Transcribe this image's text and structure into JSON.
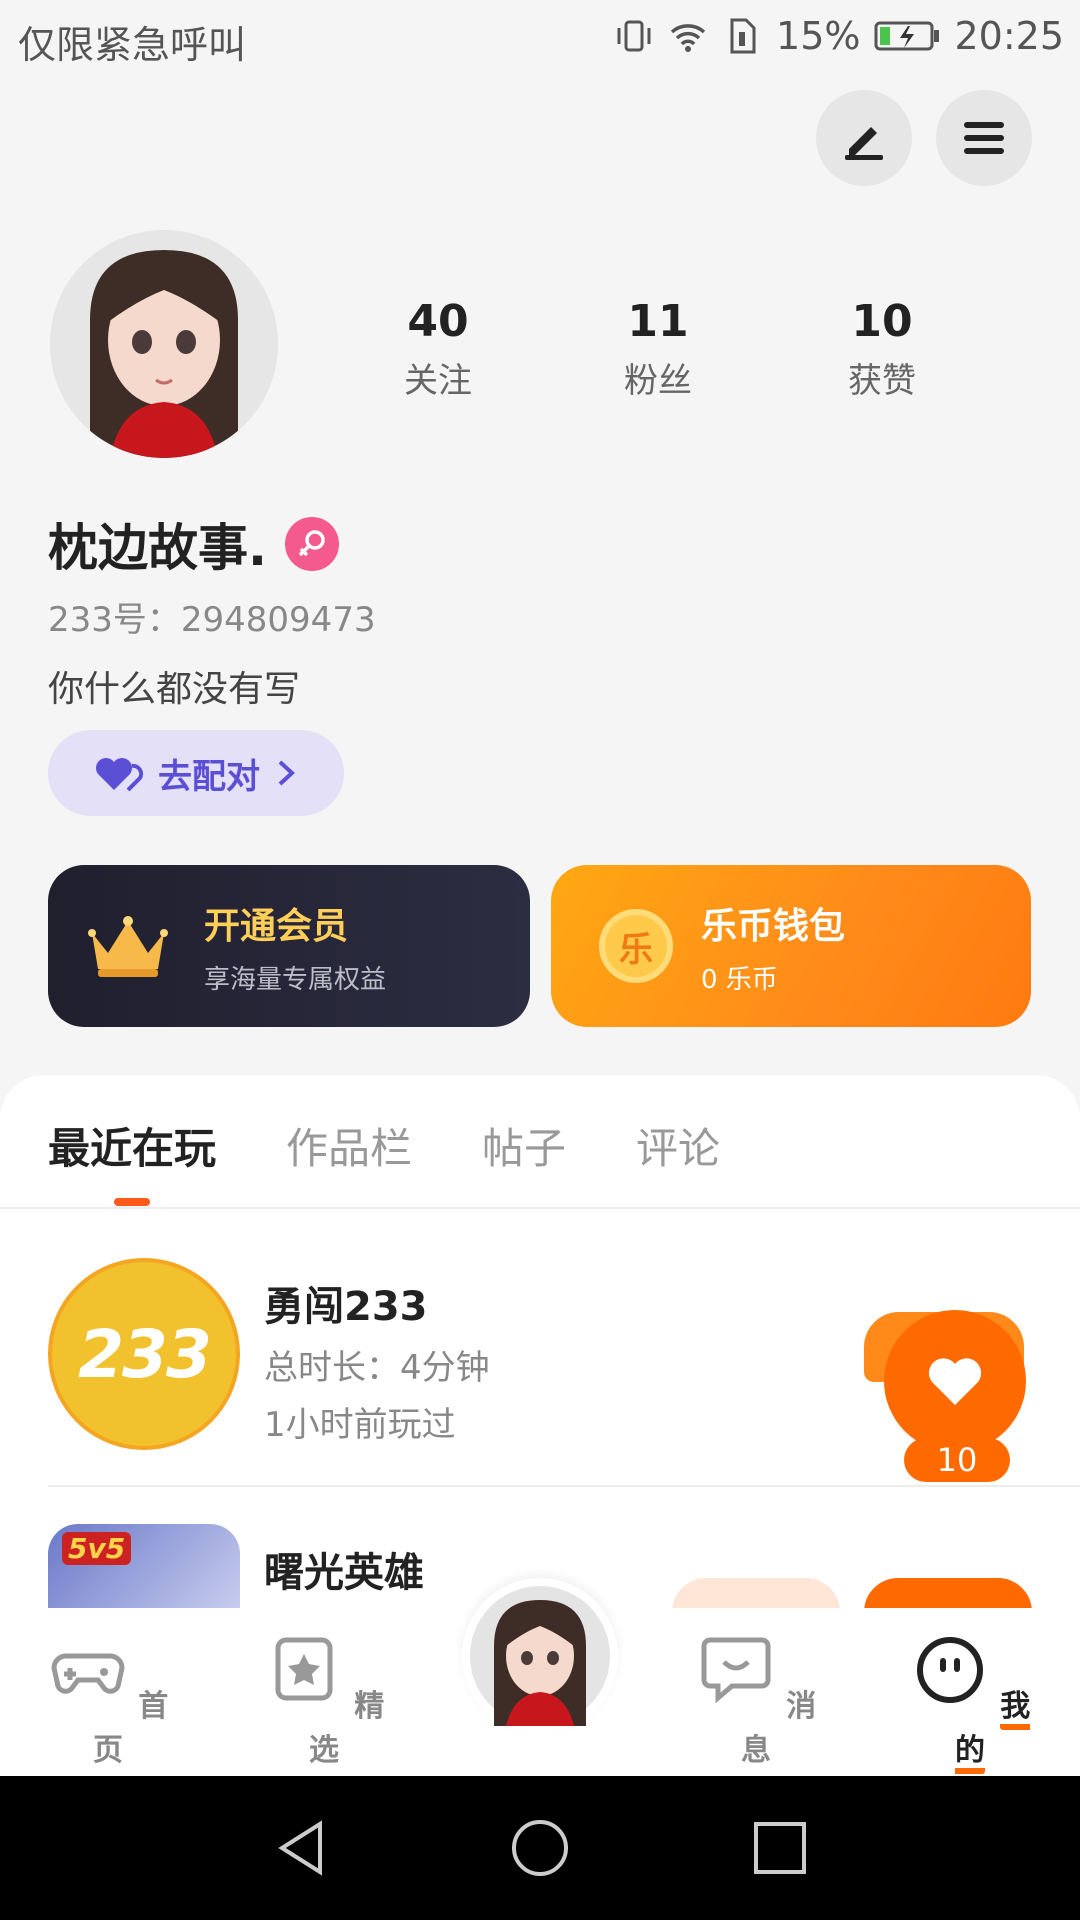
{
  "status_bar": {
    "left_text": "仅限紧急呼叫",
    "battery": "15%",
    "time": "20:25"
  },
  "profile": {
    "name": "枕边故事.",
    "uid": "233号：294809473",
    "bio": "你什么都没有写",
    "stats": [
      {
        "value": "40",
        "label": "关注"
      },
      {
        "value": "11",
        "label": "粉丝"
      },
      {
        "value": "10",
        "label": "获赞"
      }
    ],
    "pair_button": "去配对"
  },
  "cards": {
    "vip": {
      "title": "开通会员",
      "sub": "享海量专属权益"
    },
    "coin": {
      "title": "乐币钱包",
      "sub": "0 乐币",
      "icon_char": "乐"
    }
  },
  "tabs": [
    "最近在玩",
    "作品栏",
    "帖子",
    "评论"
  ],
  "games": [
    {
      "title": "勇闯233",
      "duration": "总时长：4分钟",
      "last_played": "1小时前玩过",
      "icon_text": "233",
      "likes": "10"
    },
    {
      "title": "曙光英雄",
      "badge": "5v5"
    }
  ],
  "bottom_nav": [
    {
      "label": "首页"
    },
    {
      "label": "精选"
    },
    {
      "label": "消息"
    },
    {
      "label": "我的"
    }
  ],
  "colors": {
    "accent_orange": "#ff6a00",
    "purple": "#5b4fd6",
    "pink": "#f45a8d",
    "gold": "#ffcf5a"
  }
}
